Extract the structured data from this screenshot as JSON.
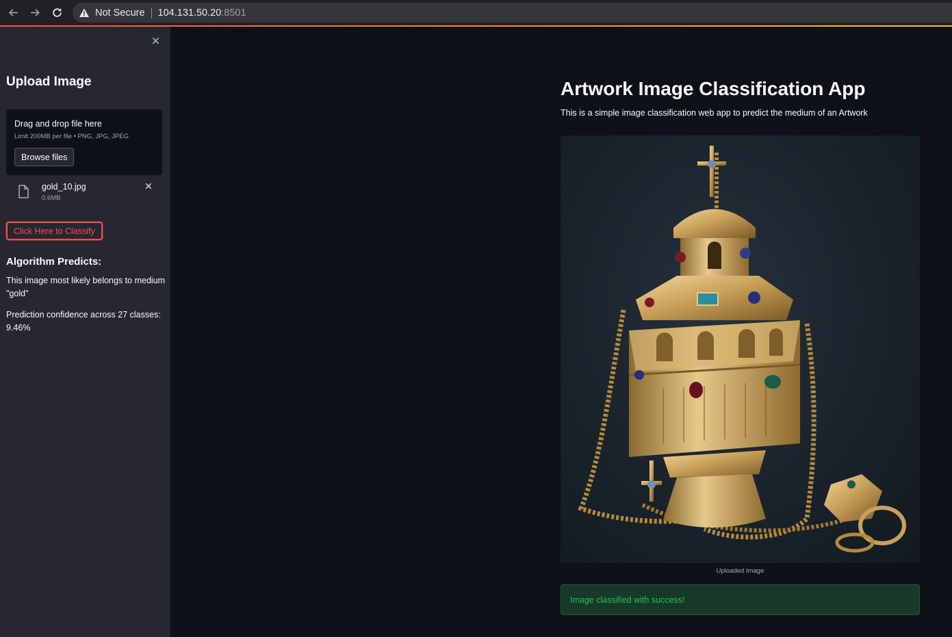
{
  "browser": {
    "security_label": "Not Secure",
    "url_host": "104.131.50.20",
    "url_port": ":8501",
    "icons": [
      "back-arrow-icon",
      "forward-arrow-icon",
      "reload-icon",
      "warning-icon"
    ]
  },
  "sidebar": {
    "title": "Upload Image",
    "uploader": {
      "drop_label": "Drag and drop file here",
      "limit_label": "Limit 200MB per file • PNG, JPG, JPEG",
      "browse_label": "Browse files"
    },
    "file": {
      "name": "gold_10.jpg",
      "size": "0.6MB"
    },
    "classify_label": "Click Here to Classify",
    "result_title": "Algorithm Predicts:",
    "prediction_text": "This image most likely belongs to medium \"gold\"",
    "confidence_text": "Prediction confidence across 27 classes: 9.46%"
  },
  "main": {
    "title": "Artwork Image Classification App",
    "description": "This is a simple image classification web app to predict the medium of an Artwork",
    "image_caption": "Uploaded Image",
    "success_message": "Image classified with success!"
  },
  "colors": {
    "primary": "#ff4b4b",
    "background": "#0e1117",
    "sidebar_bg": "#262730",
    "success_text": "#21c354",
    "success_bg": "#173928"
  }
}
